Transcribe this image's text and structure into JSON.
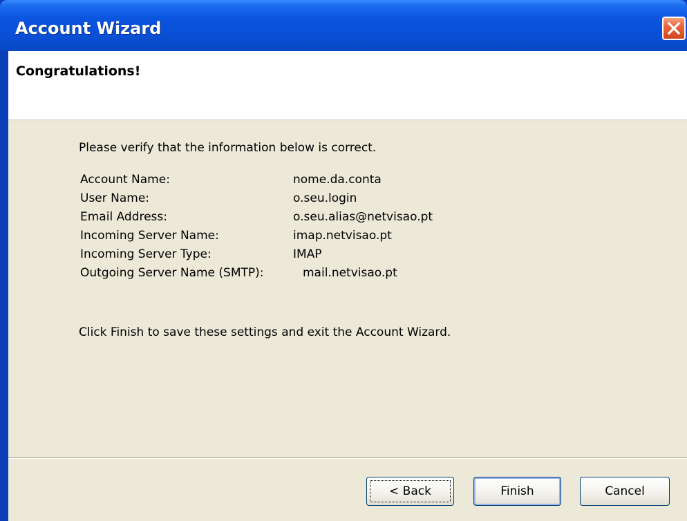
{
  "window": {
    "title": "Account Wizard"
  },
  "header": {
    "title": "Congratulations!"
  },
  "content": {
    "intro": "Please verify that the information below is correct.",
    "summary": [
      {
        "label": "Account Name:",
        "value": "nome.da.conta"
      },
      {
        "label": "User Name:",
        "value": "o.seu.login"
      },
      {
        "label": "Email Address:",
        "value": "o.seu.alias@netvisao.pt"
      },
      {
        "label": "Incoming Server Name:",
        "value": "imap.netvisao.pt"
      },
      {
        "label": "Incoming Server Type:",
        "value": "IMAP"
      },
      {
        "label": "Outgoing Server Name (SMTP):",
        "value": "mail.netvisao.pt"
      }
    ],
    "outro": "Click Finish to save these settings and exit the Account Wizard."
  },
  "buttons": {
    "back": "< Back",
    "finish": "Finish",
    "cancel": "Cancel"
  },
  "icons": {
    "close": "close-icon"
  },
  "colors": {
    "titlebar": "#0a4fd6",
    "close_button": "#e8653d",
    "dialog_background": "#ece9d8",
    "header_background": "#ffffff"
  }
}
